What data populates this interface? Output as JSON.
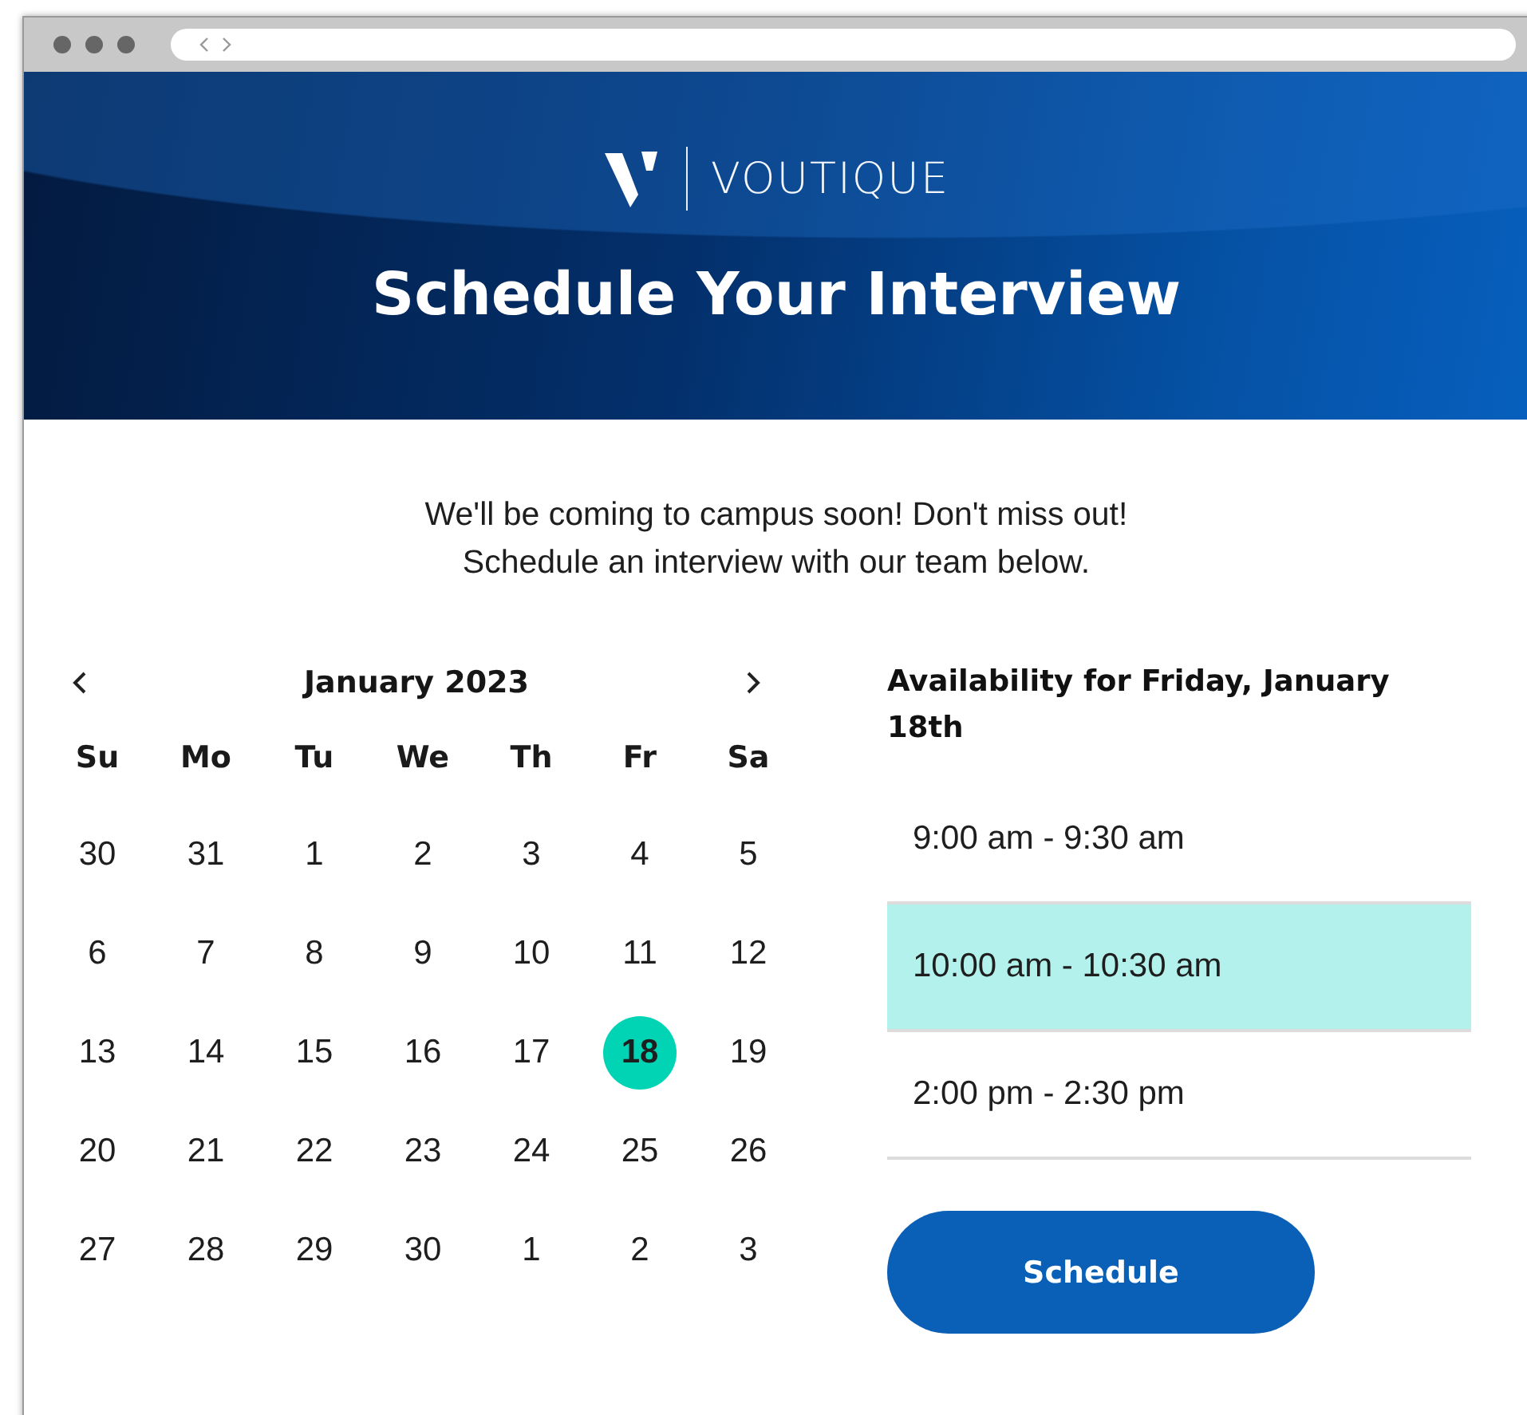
{
  "header": {
    "brand_name": "VOUTIQUE",
    "title": "Schedule Your Interview"
  },
  "intro": [
    "We'll be coming to campus soon! Don't miss out!",
    "Schedule an interview with our team below."
  ],
  "calendar": {
    "month": "January 2023",
    "weekdays": [
      "Su",
      "Mo",
      "Tu",
      "We",
      "Th",
      "Fr",
      "Sa"
    ],
    "weeks": [
      [
        {
          "label": "30",
          "selected": false
        },
        {
          "label": "31",
          "selected": false
        },
        {
          "label": "1",
          "selected": false
        },
        {
          "label": "2",
          "selected": false
        },
        {
          "label": "3",
          "selected": false
        },
        {
          "label": "4",
          "selected": false
        },
        {
          "label": "5",
          "selected": false
        }
      ],
      [
        {
          "label": "6",
          "selected": false
        },
        {
          "label": "7",
          "selected": false
        },
        {
          "label": "8",
          "selected": false
        },
        {
          "label": "9",
          "selected": false
        },
        {
          "label": "10",
          "selected": false
        },
        {
          "label": "11",
          "selected": false
        },
        {
          "label": "12",
          "selected": false
        }
      ],
      [
        {
          "label": "13",
          "selected": false
        },
        {
          "label": "14",
          "selected": false
        },
        {
          "label": "15",
          "selected": false
        },
        {
          "label": "16",
          "selected": false
        },
        {
          "label": "17",
          "selected": false
        },
        {
          "label": "18",
          "selected": true
        },
        {
          "label": "19",
          "selected": false
        }
      ],
      [
        {
          "label": "20",
          "selected": false
        },
        {
          "label": "21",
          "selected": false
        },
        {
          "label": "22",
          "selected": false
        },
        {
          "label": "23",
          "selected": false
        },
        {
          "label": "24",
          "selected": false
        },
        {
          "label": "25",
          "selected": false
        },
        {
          "label": "26",
          "selected": false
        }
      ],
      [
        {
          "label": "27",
          "selected": false
        },
        {
          "label": "28",
          "selected": false
        },
        {
          "label": "29",
          "selected": false
        },
        {
          "label": "30",
          "selected": false
        },
        {
          "label": "1",
          "selected": false
        },
        {
          "label": "2",
          "selected": false
        },
        {
          "label": "3",
          "selected": false
        }
      ]
    ]
  },
  "availability": {
    "heading": "Availability for Friday, January 18th",
    "slots": [
      {
        "label": "9:00 am - 9:30 am",
        "selected": false
      },
      {
        "label": "10:00 am - 10:30 am",
        "selected": true
      },
      {
        "label": "2:00 pm - 2:30 pm",
        "selected": false
      }
    ],
    "button": "Schedule"
  }
}
